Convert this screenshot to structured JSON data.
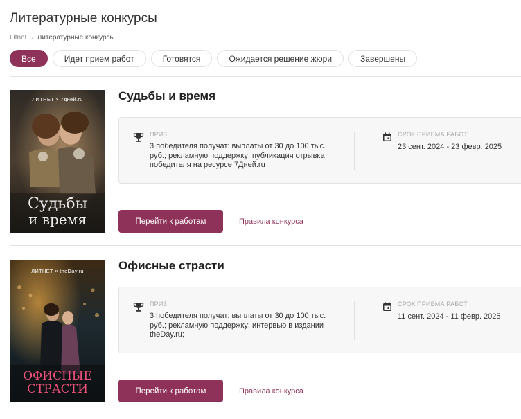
{
  "page": {
    "title": "Литературные конкурсы",
    "breadcrumb": {
      "root": "Litnet",
      "separator": ">",
      "current": "Литературные конкурсы"
    }
  },
  "filters": [
    {
      "label": "Все",
      "active": true
    },
    {
      "label": "Идет прием работ",
      "active": false
    },
    {
      "label": "Готовятся",
      "active": false
    },
    {
      "label": "Ожидается решение жюри",
      "active": false
    },
    {
      "label": "Завершены",
      "active": false
    }
  ],
  "contests": [
    {
      "title": "Судьбы и время",
      "cover": {
        "partners": "ЛИТНЕТ × 7дней.ru",
        "line1": "Судьбы",
        "line2": "и время"
      },
      "prize_label": "ПРИЗ",
      "prize_text": "3 победителя получат: выплаты от 30 до 100 тыс. руб.; рекламную поддержку; публикация отрывка победителя на ресурсе 7Дней.ru",
      "deadline_label": "СРОК ПРИЕМА РАБОТ",
      "deadline": "23 сент. 2024 - 23 февр. 2025",
      "works_button": "Перейти к работам",
      "rules_link": "Правила конкурса"
    },
    {
      "title": "Офисные страсти",
      "cover": {
        "partners": "ЛИТНЕТ × theDay.ru",
        "line1": "ОФИСНЫЕ",
        "line2": "СТРАСТИ"
      },
      "prize_label": "ПРИЗ",
      "prize_text": "3 победителя получат: выплаты от 30 до 100 тыс. руб.; рекламную поддержку; интервью в издании theDay.ru;",
      "deadline_label": "СРОК ПРИЕМА РАБОТ",
      "deadline": "11 сент. 2024 - 11 февр. 2025",
      "works_button": "Перейти к работам",
      "rules_link": "Правила конкурса"
    }
  ],
  "colors": {
    "accent": "#8e3259",
    "border": "#e2e2e2",
    "panel": "#f7f7f7"
  }
}
